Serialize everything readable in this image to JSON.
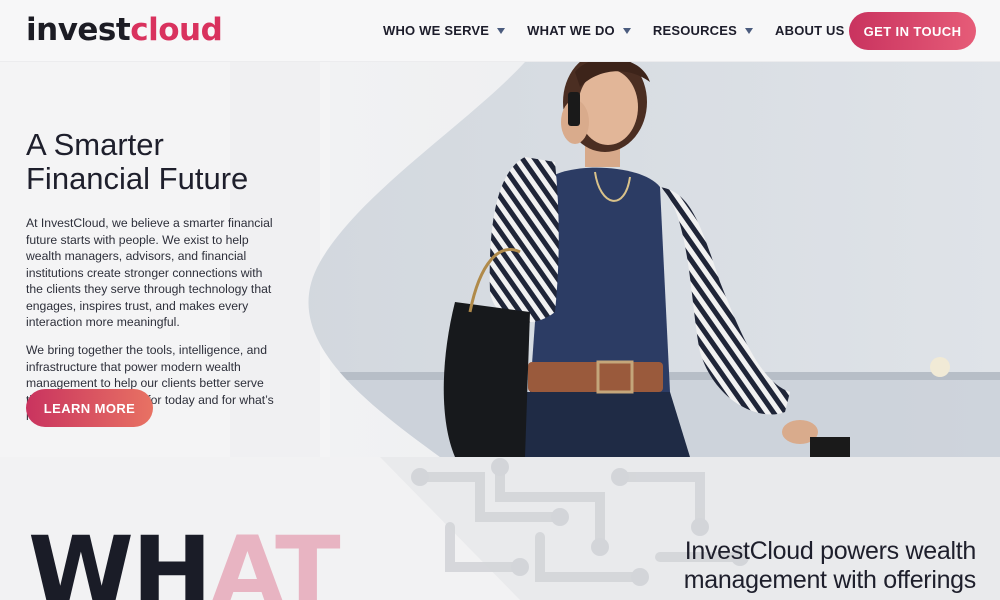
{
  "header": {
    "logo_part1": "invest",
    "logo_part2": "cloud",
    "nav": [
      {
        "label": "WHO WE SERVE"
      },
      {
        "label": "WHAT WE DO"
      },
      {
        "label": "RESOURCES"
      },
      {
        "label": "ABOUT US"
      }
    ],
    "cta_label": "GET IN TOUCH"
  },
  "hero": {
    "title_line1": "A Smarter",
    "title_line2": "Financial Future",
    "paragraph1": "At InvestCloud, we believe a smarter financial future starts with people. We exist to help wealth managers, advisors, and financial institutions create stronger connections with the clients they serve through technology that engages, inspires trust, and makes every interaction more meaningful.",
    "paragraph2": "We bring together the tools, intelligence, and infrastructure that power modern wealth management to help our clients better serve their own clients, both for today and for what’s next.",
    "button_label": "LEARN MORE"
  },
  "section2": {
    "big_word_part1": "WH",
    "big_word_part2": "AT",
    "headline_line1": "InvestCloud powers wealth",
    "headline_line2": "management with offerings"
  },
  "colors": {
    "brand_pink": "#d9325e",
    "dark": "#1c1c24",
    "caret": "#4b5c7e"
  }
}
